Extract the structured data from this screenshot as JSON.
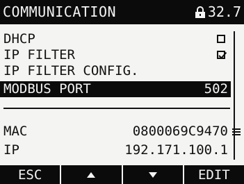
{
  "header": {
    "title": "COMMUNICATION",
    "status_value": "32.7",
    "status_icon": "lock-icon"
  },
  "menu": {
    "items": [
      {
        "label": "DHCP",
        "checked": false
      },
      {
        "label": "IP FILTER",
        "checked": true
      },
      {
        "label": "IP FILTER CONFIG."
      },
      {
        "label": "MODBUS PORT",
        "value": "502",
        "selected": true
      }
    ]
  },
  "info": {
    "mac_label": "MAC",
    "mac_value": "0800069C9470",
    "ip_label": "IP",
    "ip_value": "192.171.100.1"
  },
  "footer": {
    "esc_label": "ESC",
    "up_icon": "arrow-up-icon",
    "down_icon": "arrow-down-icon",
    "edit_label": "EDIT"
  },
  "colors": {
    "background": "#f4f4f2",
    "foreground": "#111111",
    "inverse_bg": "#0b0b0b"
  }
}
